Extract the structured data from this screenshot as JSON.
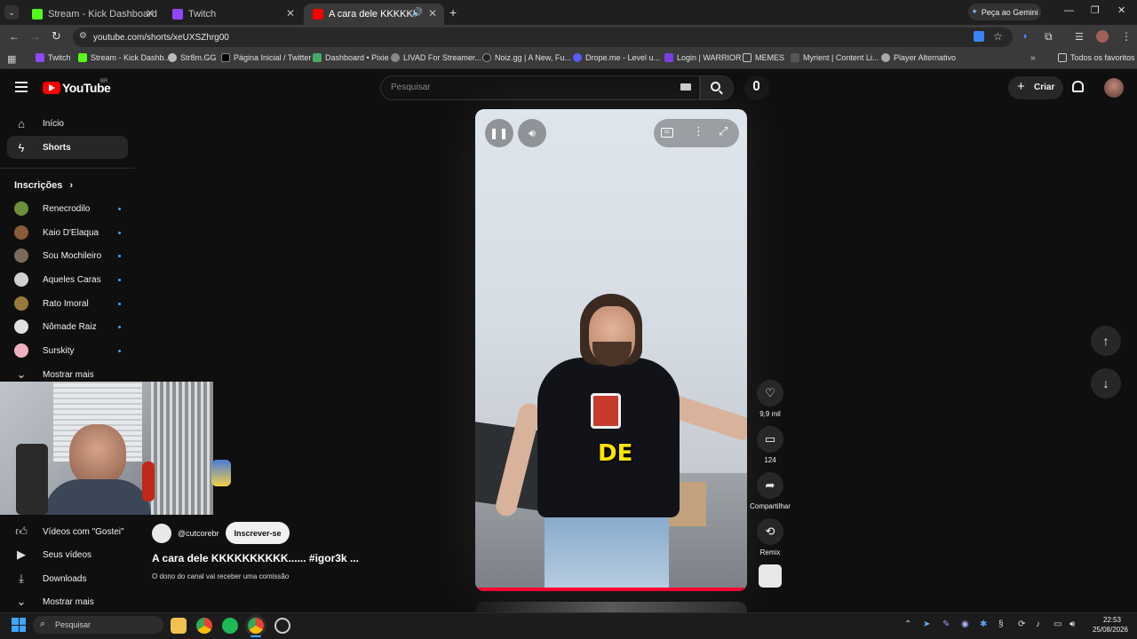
{
  "browser": {
    "tabs": [
      {
        "title": "Stream - Kick Dashboard",
        "color": "#53fc18"
      },
      {
        "title": "Twitch",
        "color": "#9146ff"
      },
      {
        "title": "A cara dele KKKKKKKKKK...",
        "color": "#ff0000"
      }
    ],
    "gemini_label": "Peça ao Gemini",
    "url": "youtube.com/shorts/xeUXSZhrg00",
    "bookmarks": [
      "Twitch",
      "Stream - Kick Dashb...",
      "Str8m.GG",
      "Página Inicial / Twitter",
      "Dashboard • Pixie",
      "LIVAD For Streamer...",
      "Noiz.gg | A New, Fu...",
      "Drope.me - Level u...",
      "Login | WARRIOR",
      "MEMES",
      "Myrient | Content Li...",
      "Player Alternativo"
    ],
    "all_bookmarks": "Todos os favoritos"
  },
  "yt": {
    "logo_text": "YouTube",
    "region": "BR",
    "search_placeholder": "Pesquisar",
    "create_label": "Criar"
  },
  "sidebar": {
    "home": "Início",
    "shorts": "Shorts",
    "subscriptions_title": "Inscrições",
    "subscriptions": [
      {
        "name": "Renecrodilo",
        "color": "#6b8f3a"
      },
      {
        "name": "Kaio D'Elaqua",
        "color": "#8a5a3c"
      },
      {
        "name": "Sou Mochileiro",
        "color": "#7a6a5a"
      },
      {
        "name": "Aqueles Caras",
        "color": "#d0d0d0"
      },
      {
        "name": "Rato Imoral",
        "color": "#9a7a3a"
      },
      {
        "name": "Nômade Raiz",
        "color": "#e0e0e0"
      },
      {
        "name": "Surskity",
        "color": "#f0b0c0"
      }
    ],
    "show_more": "Mostrar mais",
    "liked": "Vídeos com \"Gostei\"",
    "your_videos": "Seus vídeos",
    "downloads": "Downloads",
    "show_more_2": "Mostrar mais"
  },
  "short": {
    "channel": "@cutcorebr",
    "subscribe": "Inscrever-se",
    "title": "A cara dele KKKKKKKKKK...... #igor3k ...",
    "subtitle": "O dono do canal vai receber uma comissão",
    "caption_word": "DE",
    "likes": "9,9 mil",
    "comments": "124",
    "share": "Compartilhar",
    "remix": "Remix",
    "progress": 0.99
  },
  "taskbar": {
    "search_placeholder": "Pesquisar",
    "time": "22:53",
    "date": "25/08/2026"
  }
}
